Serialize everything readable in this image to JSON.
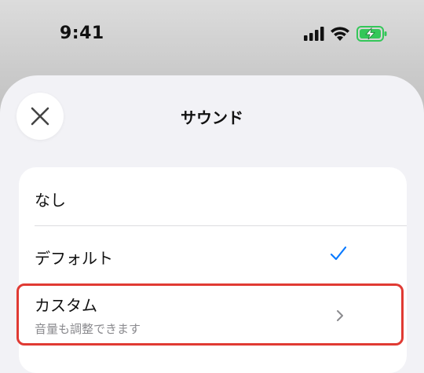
{
  "status_bar": {
    "time": "9:41",
    "battery_color": "#34c759"
  },
  "sheet": {
    "title": "サウンド",
    "close_icon": "close-icon"
  },
  "options": [
    {
      "label": "なし",
      "selected": false
    },
    {
      "label": "デフォルト",
      "selected": true,
      "icon": "checkmark-icon"
    },
    {
      "label": "カスタム",
      "subtitle": "音量も調整できます",
      "icon": "chevron-right-icon",
      "highlighted": true
    }
  ],
  "colors": {
    "accent": "#0a7aff",
    "highlight_border": "#e03a33"
  }
}
